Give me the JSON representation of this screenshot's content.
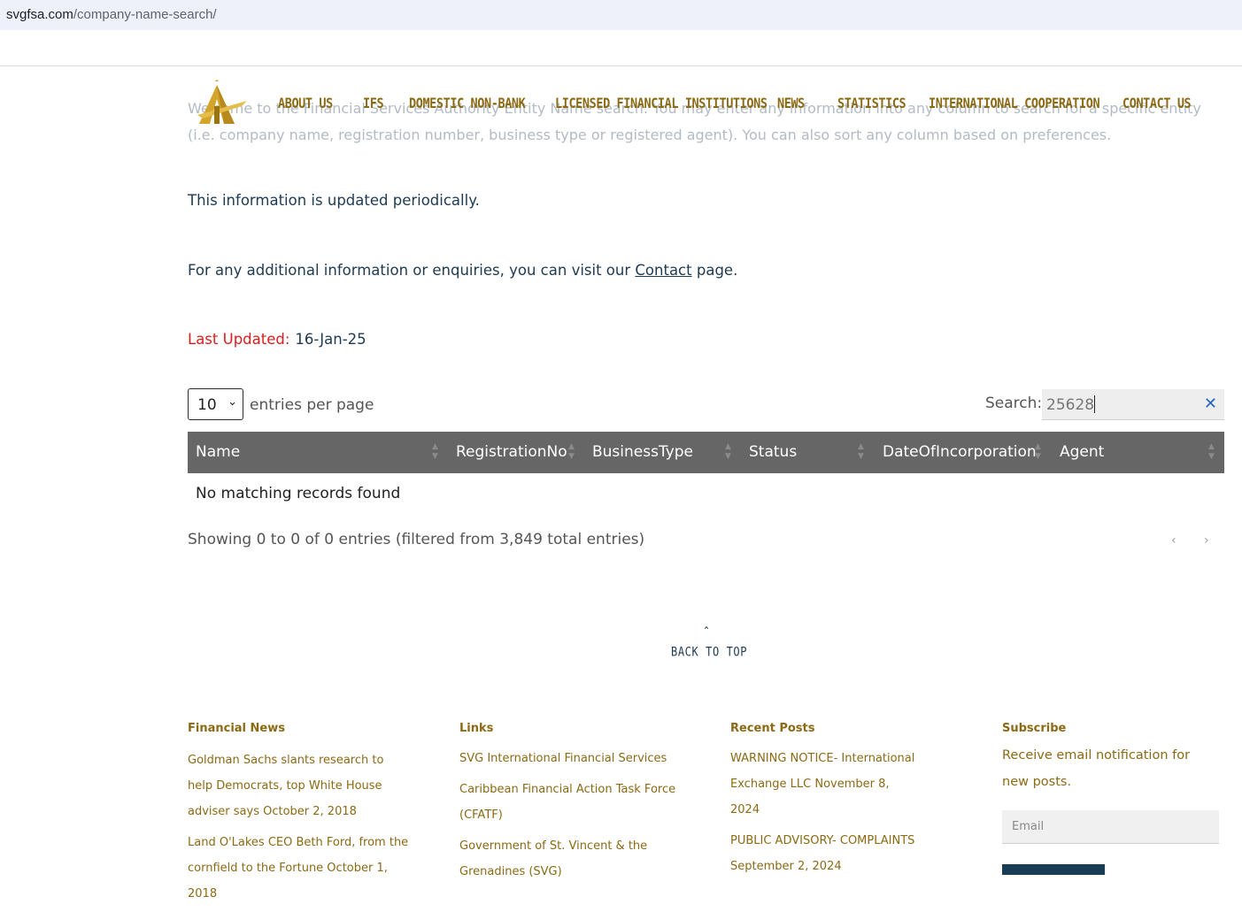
{
  "browser": {
    "url_host": "svgfsa.com",
    "url_path": "/company-name-search/"
  },
  "nav": {
    "items": [
      "ABOUT US",
      "IFS",
      "DOMESTIC NON-BANK",
      "LICENSED FINANCIAL INSTITUTIONS",
      "NEWS",
      "STATISTICS",
      "INTERNATIONAL COOPERATION",
      "CONTACT US"
    ]
  },
  "content": {
    "intro": "Welcome to the Financial Services Authority Entity Name search. You may enter any information into any column to search for a specific entity (i.e. company name, registration number, business type or registered agent). You can also sort any column based on preferences.",
    "updated_note": "This information is updated periodically.",
    "enquiries_before": "For any additional information or enquiries, you can visit our ",
    "enquiries_link": "Contact",
    "enquiries_after": " page.",
    "last_updated_label": "Last Updated:",
    "last_updated_value": "16-Jan-25"
  },
  "table": {
    "entries_value": "10",
    "entries_label": "entries per page",
    "search_label": "Search:",
    "search_value": "25628",
    "columns": [
      "Name",
      "RegistrationNo",
      "BusinessType",
      "Status",
      "DateOfIncorporation",
      "Agent"
    ],
    "empty_message": "No matching records found",
    "summary": "Showing 0 to 0 of 0 entries (filtered from 3,849 total entries)"
  },
  "back_to_top": "BACK TO TOP",
  "footer": {
    "financial_news": {
      "title": "Financial News",
      "items": [
        "Goldman Sachs slants research to help Democrats, top White House adviser says October 2, 2018",
        "Land O'Lakes CEO Beth Ford, from the cornfield to the Fortune October 1, 2018"
      ]
    },
    "links": {
      "title": "Links",
      "items": [
        "SVG International Financial Services",
        "Caribbean Financial Action Task Force (CFATF)",
        "Government of St. Vincent & the Grenadines (SVG)"
      ]
    },
    "recent_posts": {
      "title": "Recent Posts",
      "items": [
        "WARNING NOTICE- International Exchange LLC November 8, 2024",
        "PUBLIC ADVISORY- COMPLAINTS September 2, 2024"
      ]
    },
    "subscribe": {
      "title": "Subscribe",
      "text": "Receive email notification for new posts.",
      "email_placeholder": "Email"
    }
  }
}
